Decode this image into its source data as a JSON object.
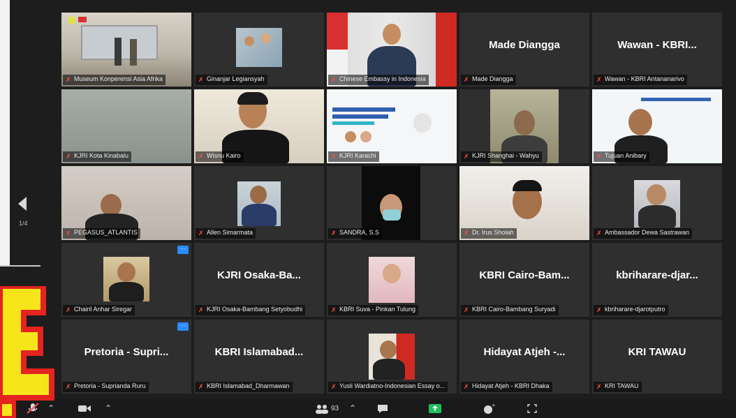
{
  "pagination": {
    "page_indicator": "1/4"
  },
  "participants": [
    {
      "label": "Museum Konperensi Asia Afrika",
      "display": "",
      "active": true
    },
    {
      "label": "Ginanjar Legiansyah",
      "display": ""
    },
    {
      "label": "Chinese Embassy in Indonesia",
      "display": ""
    },
    {
      "label": "Made Diangga",
      "display": "Made Diangga"
    },
    {
      "label": "Wawan - KBRI Antananarivo",
      "display": "Wawan - KBRI..."
    },
    {
      "label": "KJRI Kota Kinabalu",
      "display": ""
    },
    {
      "label": "Wisnu Kairo",
      "display": ""
    },
    {
      "label": "KJRI Karachi",
      "display": ""
    },
    {
      "label": "KJRI Shanghai - Wahyu",
      "display": ""
    },
    {
      "label": "Tujuan Anibary",
      "display": ""
    },
    {
      "label": "PEGASUS_ATLANTIS",
      "display": ""
    },
    {
      "label": "Allen Simarmata",
      "display": ""
    },
    {
      "label": "SANDRA, S.S",
      "display": ""
    },
    {
      "label": "Dr. Irus Sholah",
      "display": ""
    },
    {
      "label": "Ambassador Dewa Sastrawan",
      "display": ""
    },
    {
      "label": "Chairil Anhar Siregar",
      "display": ""
    },
    {
      "label": "KJRI Osaka-Bambang Setyobudhi",
      "display": "KJRI Osaka-Ba..."
    },
    {
      "label": "KBRI Suva - Pinkan Tulung",
      "display": ""
    },
    {
      "label": "KBRI Cairo-Bambang Suryadi",
      "display": "KBRI Cairo-Bam..."
    },
    {
      "label": "kbriharare-djarotputro",
      "display": "kbriharare-djar..."
    },
    {
      "label": "Pretoria - Suprianda Ruru",
      "display": "Pretoria - Supri..."
    },
    {
      "label": "KBRI Islamabad_Dharmawan",
      "display": "KBRI Islamabad..."
    },
    {
      "label": "Yusli Wardiatno-Indonesian Essay o...",
      "display": ""
    },
    {
      "label": "Hidayat Atjeh - KBRI Dhaka",
      "display": "Hidayat Atjeh -..."
    },
    {
      "label": "KRI TAWAU",
      "display": "KRI TAWAU"
    }
  ],
  "toolbar": {
    "participants_count": "93"
  },
  "colors": {
    "active_border": "#e9e65a",
    "more_button": "#2d8cff",
    "muted_mic": "#ff4d4d",
    "tile_bg": "#2f2f2f"
  }
}
